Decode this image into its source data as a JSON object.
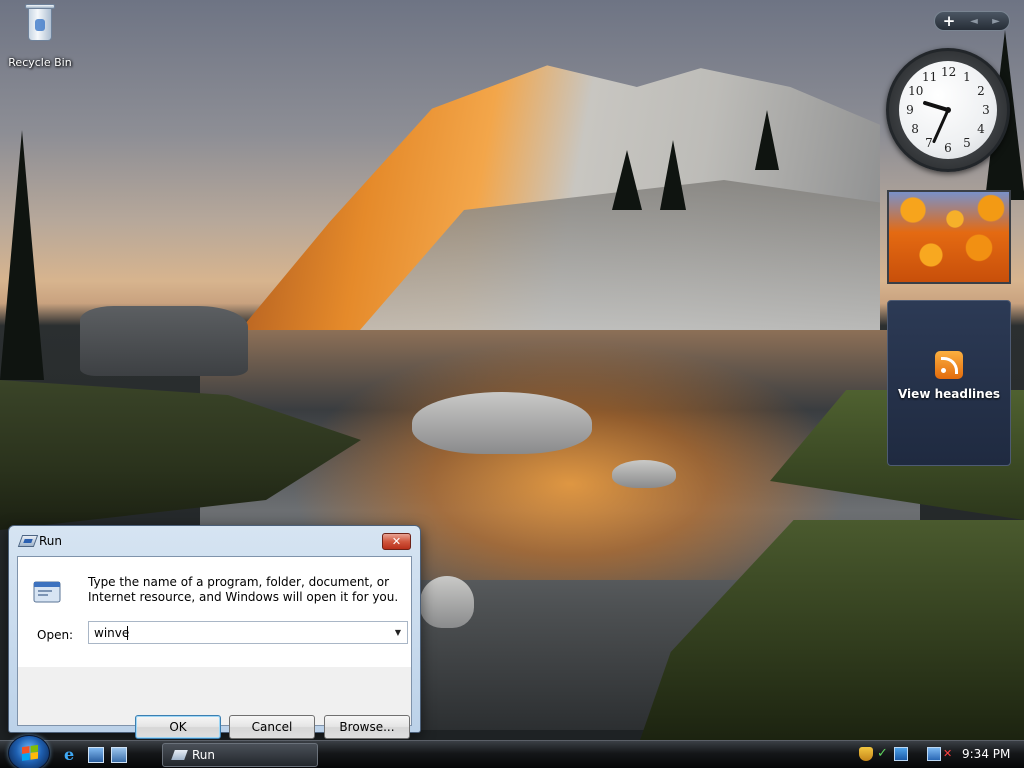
{
  "desktop": {
    "icons": [
      {
        "label": "Recycle Bin",
        "icon": "recycle-bin-icon"
      }
    ]
  },
  "sidebar": {
    "add_glyph": "+",
    "prev_glyph": "◄",
    "next_glyph": "►",
    "clock": {
      "numbers": [
        "12",
        "1",
        "2",
        "3",
        "4",
        "5",
        "6",
        "7",
        "8",
        "9",
        "10",
        "11"
      ],
      "hour": 9,
      "minute": 34
    },
    "feed": {
      "label": "View headlines",
      "icon": "rss-feed-icon"
    }
  },
  "run_dialog": {
    "title": "Run",
    "close_glyph": "✕",
    "description": "Type the name of a program, folder, document, or Internet resource, and Windows will open it for you.",
    "open_label": "Open:",
    "open_value": "winve",
    "buttons": {
      "ok": "OK",
      "cancel": "Cancel",
      "browse": "Browse..."
    }
  },
  "taskbar": {
    "ie_glyph": "e",
    "tasks": [
      {
        "label": "Run",
        "icon": "run-icon"
      }
    ],
    "tray": {
      "check_glyph": "✓",
      "mute_glyph": "✕",
      "time": "9:34 PM"
    }
  },
  "colors": {
    "titlebar": "#d6e4f2",
    "close_button": "#d1573e",
    "taskbar": "#151719",
    "feed_gadget": "#2c3a55"
  }
}
